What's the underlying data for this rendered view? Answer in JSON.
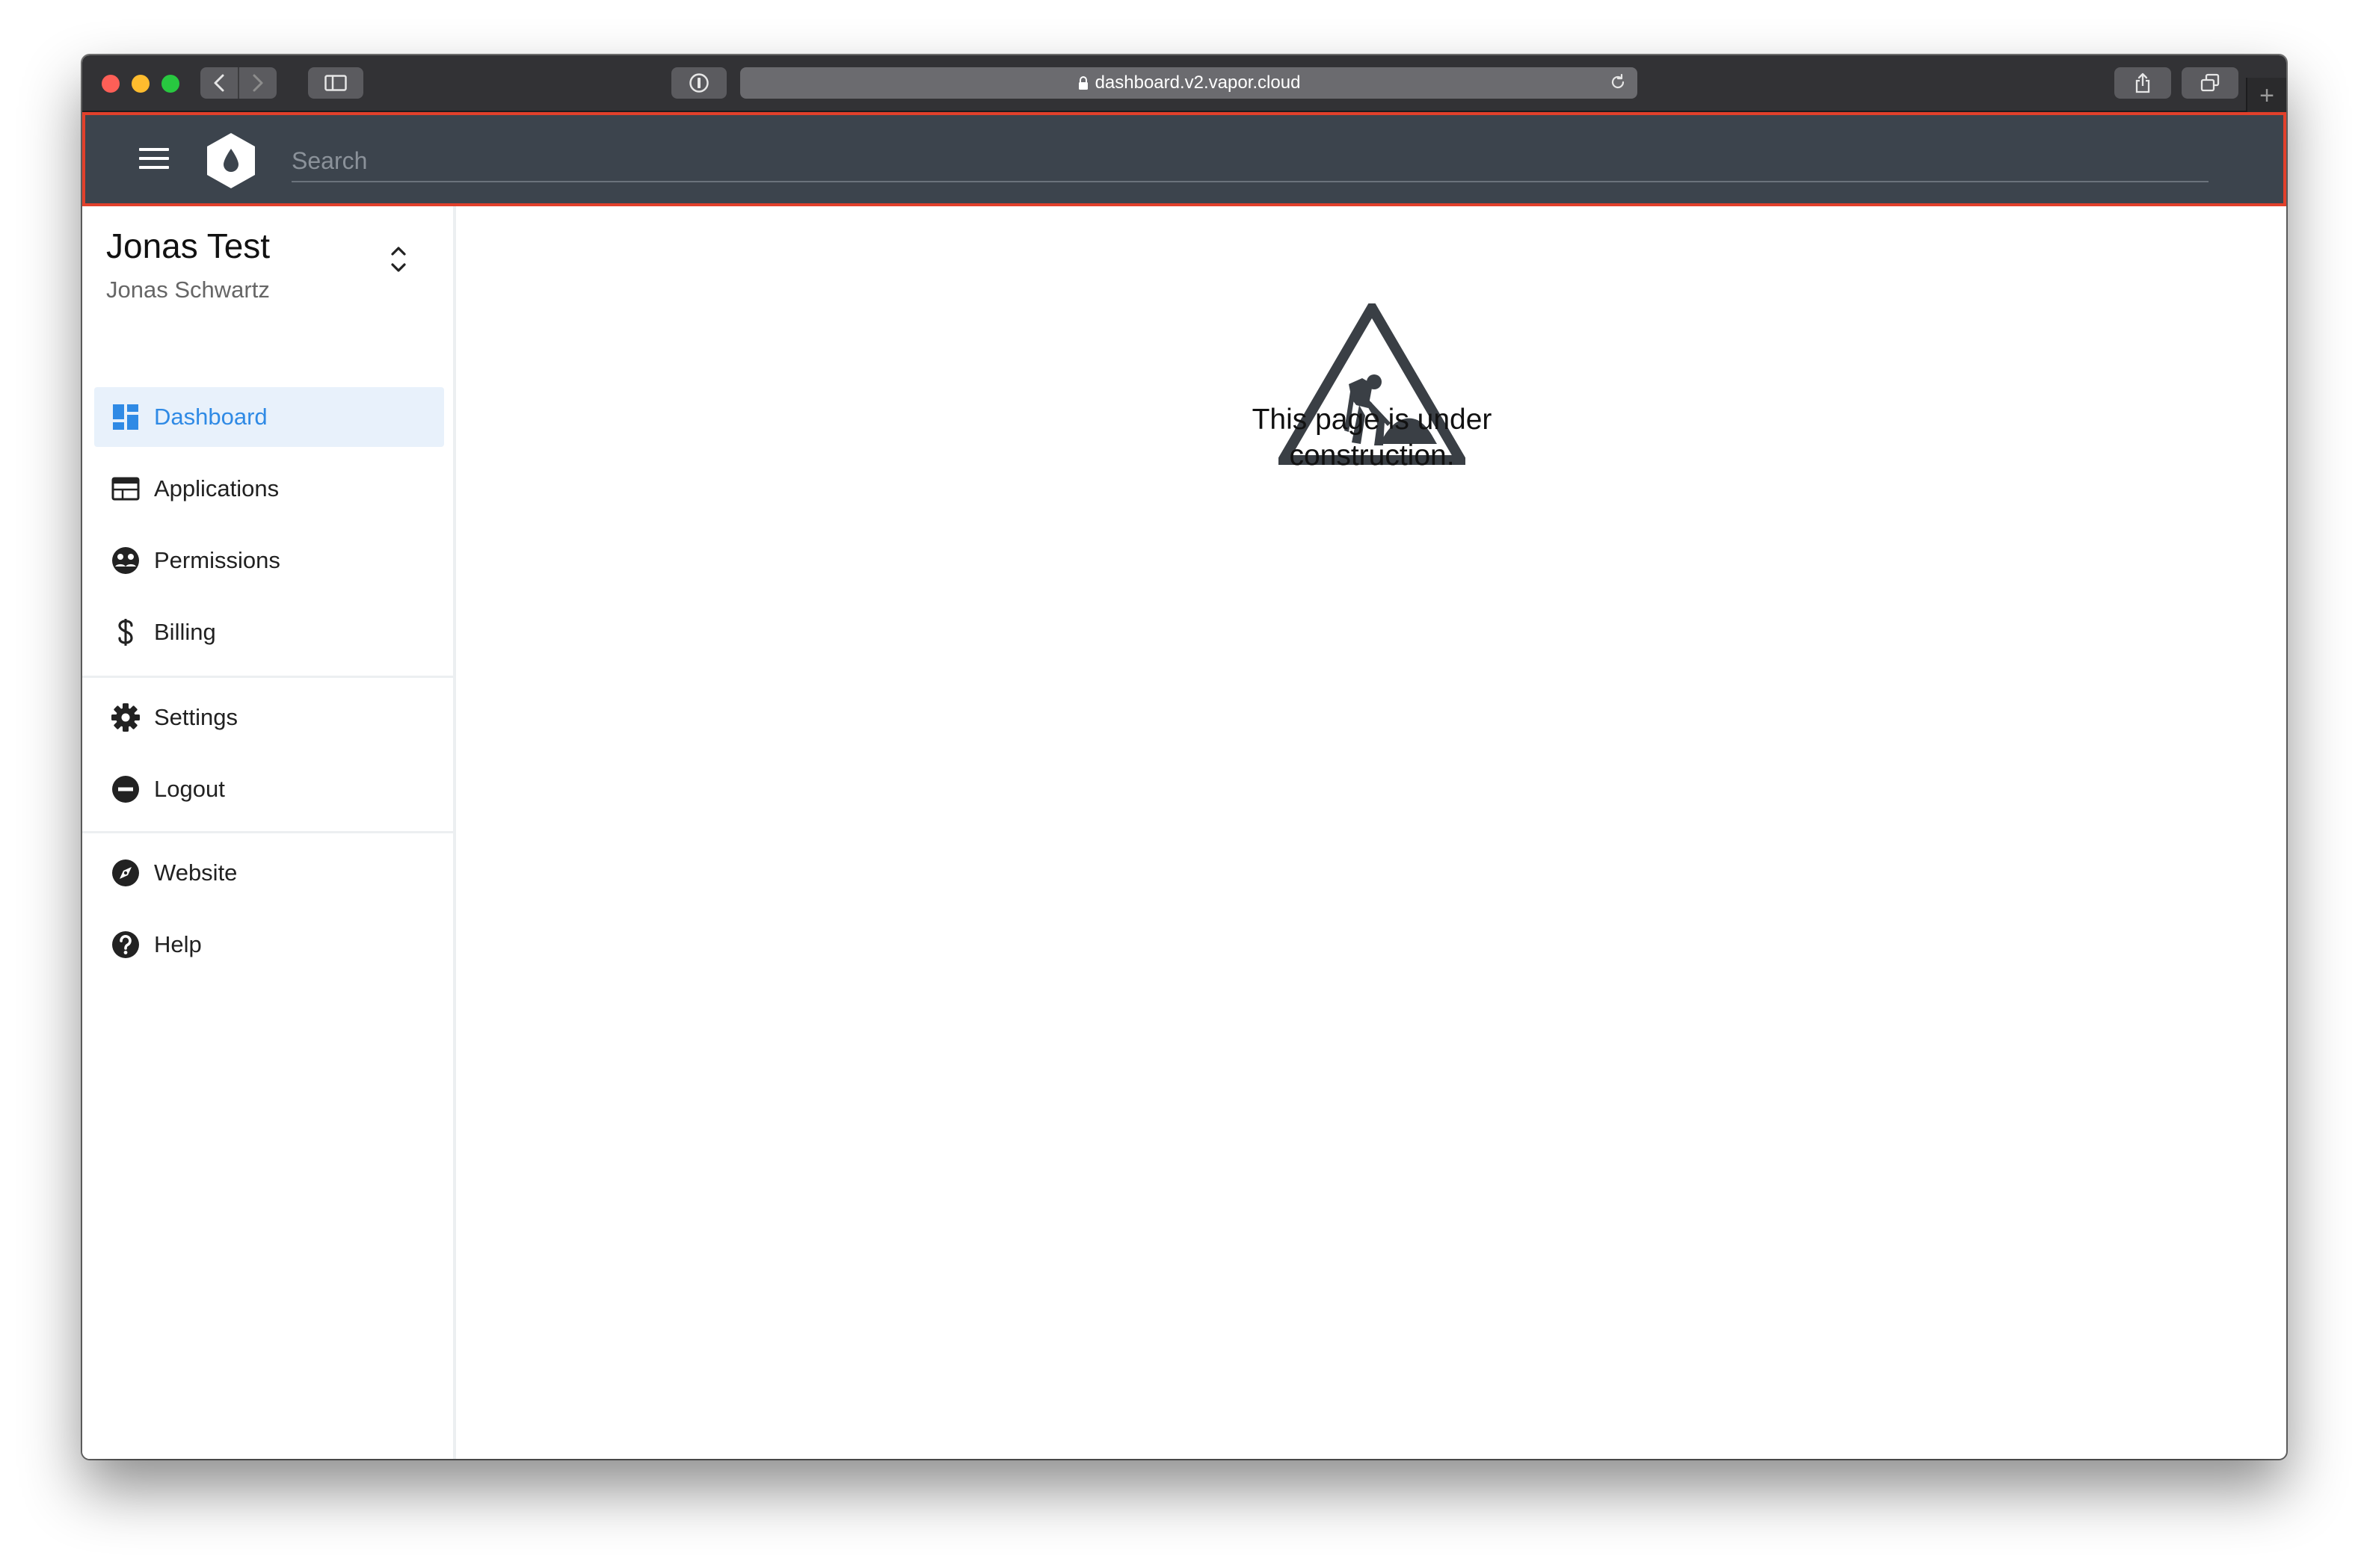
{
  "browser": {
    "url": "dashboard.v2.vapor.cloud",
    "new_tab_symbol": "+"
  },
  "header": {
    "search_placeholder": "Search",
    "accent_color": "#e2402b",
    "background_color": "#3c444d"
  },
  "account": {
    "org_name": "Jonas Test",
    "user_name": "Jonas Schwartz"
  },
  "sidebar": {
    "items": [
      {
        "label": "Dashboard",
        "icon": "dashboard-icon",
        "active": true
      },
      {
        "label": "Applications",
        "icon": "applications-icon",
        "active": false
      },
      {
        "label": "Permissions",
        "icon": "permissions-icon",
        "active": false
      },
      {
        "label": "Billing",
        "icon": "dollar-icon",
        "active": false
      }
    ],
    "account_items": [
      {
        "label": "Settings",
        "icon": "gear-icon"
      },
      {
        "label": "Logout",
        "icon": "logout-icon"
      }
    ],
    "external_items": [
      {
        "label": "Website",
        "icon": "compass-icon"
      },
      {
        "label": "Help",
        "icon": "help-icon"
      }
    ],
    "active_color": "#2f8ae5"
  },
  "main": {
    "message": "This page is under construction."
  }
}
